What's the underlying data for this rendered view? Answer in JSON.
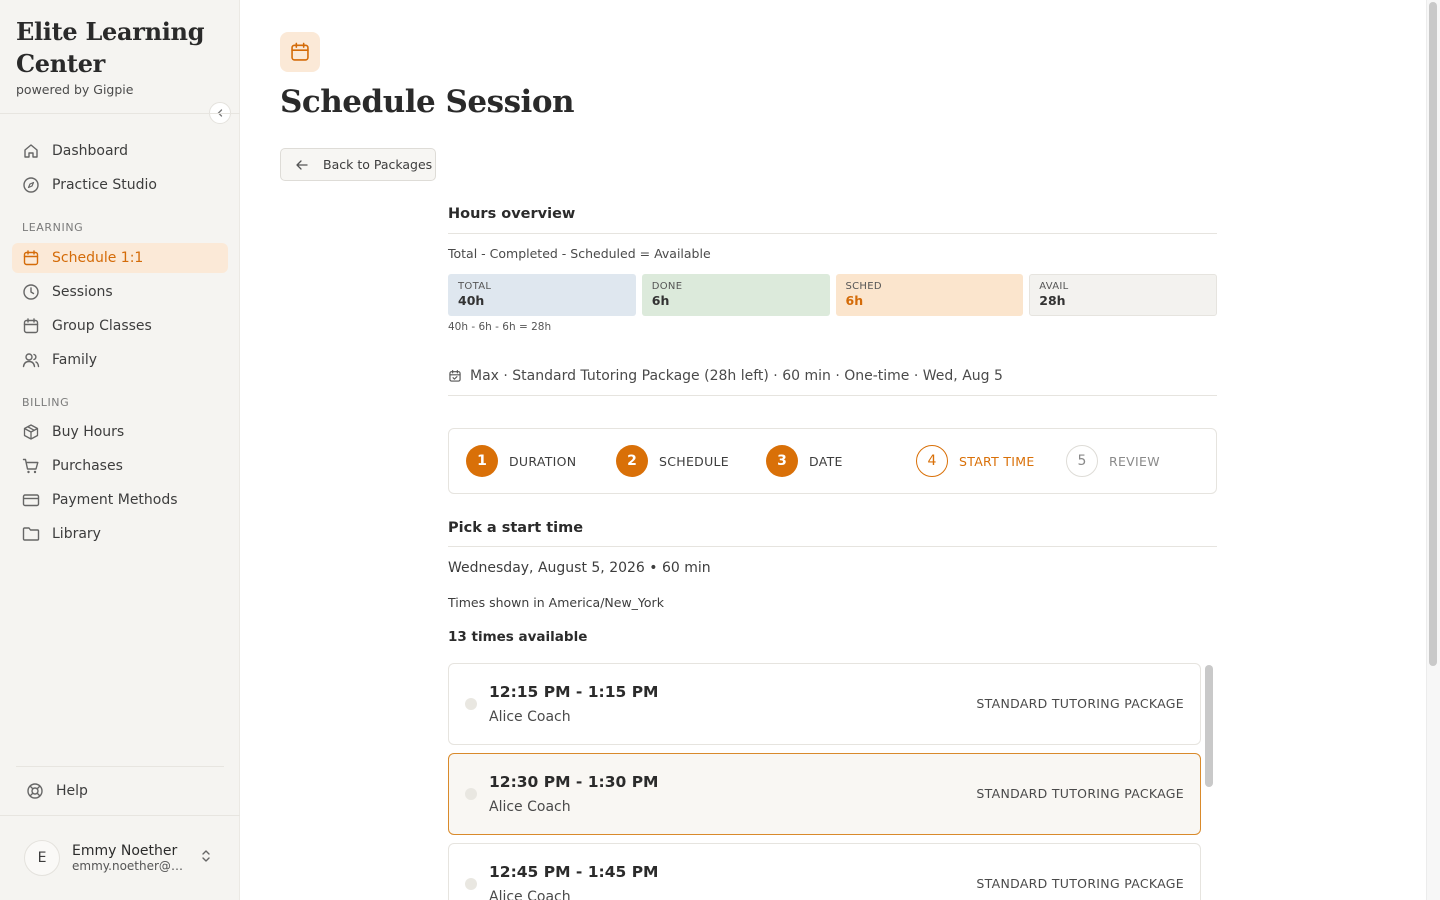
{
  "sidebar": {
    "brand_title": "Elite Learning Center",
    "brand_sub": "powered by Gigpie",
    "main_items": [
      {
        "label": "Dashboard",
        "icon": "home-icon"
      },
      {
        "label": "Practice Studio",
        "icon": "compass-icon"
      }
    ],
    "learning_label": "LEARNING",
    "learning_items": [
      {
        "label": "Schedule 1:1",
        "icon": "calendar-icon",
        "active": true
      },
      {
        "label": "Sessions",
        "icon": "clock-icon"
      },
      {
        "label": "Group Classes",
        "icon": "calendar-icon"
      },
      {
        "label": "Family",
        "icon": "users-icon"
      }
    ],
    "billing_label": "BILLING",
    "billing_items": [
      {
        "label": "Buy Hours",
        "icon": "package-icon"
      },
      {
        "label": "Purchases",
        "icon": "cart-icon"
      },
      {
        "label": "Payment Methods",
        "icon": "credit-card-icon"
      },
      {
        "label": "Library",
        "icon": "folder-icon"
      }
    ],
    "help_label": "Help",
    "user": {
      "initial": "E",
      "name": "Emmy Noether",
      "email": "emmy.noether@ex..."
    }
  },
  "header": {
    "title": "Schedule Session",
    "back_label": "Back to Packages"
  },
  "hours": {
    "section_title": "Hours overview",
    "equation": "Total - Completed - Scheduled = Available",
    "boxes": [
      {
        "label": "TOTAL",
        "value": "40h"
      },
      {
        "label": "DONE",
        "value": "6h"
      },
      {
        "label": "SCHED",
        "value": "6h"
      },
      {
        "label": "AVAIL",
        "value": "28h"
      }
    ],
    "formula": "40h - 6h - 6h = 28h"
  },
  "summary": "Max · Standard Tutoring Package (28h left) · 60 min · One-time · Wed, Aug 5",
  "steps": [
    {
      "num": "1",
      "label": "DURATION",
      "state": "done"
    },
    {
      "num": "2",
      "label": "SCHEDULE",
      "state": "done"
    },
    {
      "num": "3",
      "label": "DATE",
      "state": "done"
    },
    {
      "num": "4",
      "label": "START TIME",
      "state": "current"
    },
    {
      "num": "5",
      "label": "REVIEW",
      "state": "future"
    }
  ],
  "picker": {
    "title": "Pick a start time",
    "date_line": "Wednesday, August 5, 2026 • 60 min",
    "tz_line": "Times shown in America/New_York",
    "count_line": "13 times available"
  },
  "slots": [
    {
      "time": "12:15 PM - 1:15 PM",
      "coach": "Alice Coach",
      "package": "STANDARD TUTORING PACKAGE",
      "selected": false
    },
    {
      "time": "12:30 PM - 1:30 PM",
      "coach": "Alice Coach",
      "package": "STANDARD TUTORING PACKAGE",
      "selected": true
    },
    {
      "time": "12:45 PM - 1:45 PM",
      "coach": "Alice Coach",
      "package": "STANDARD TUTORING PACKAGE",
      "selected": false
    }
  ],
  "colors": {
    "accent": "#d97008",
    "accent_bg": "#fbe9d7"
  }
}
